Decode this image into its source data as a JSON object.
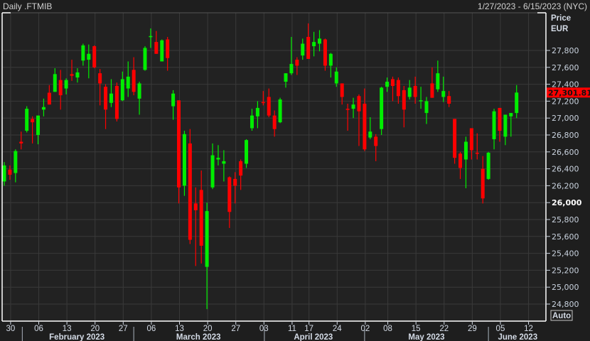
{
  "header": {
    "title": "Daily .FTMIB",
    "date_range": "1/27/2023 - 6/15/2023 (NYC)"
  },
  "axis": {
    "price_label": "Price",
    "currency_label": "EUR",
    "auto_button": "Auto",
    "last_price_label": "27,301.81"
  },
  "colors": {
    "up": "#00ee00",
    "down": "#ff0000",
    "background": "#1e1e1e",
    "plot": "#222222",
    "grid": "#3a3a3a"
  },
  "chart_data": {
    "type": "candlestick",
    "title": "Daily .FTMIB",
    "ylabel": "Price EUR",
    "ylim": [
      24700,
      28150
    ],
    "y_ticks": [
      24800,
      25000,
      25200,
      25400,
      25600,
      25800,
      26000,
      26200,
      26400,
      26600,
      26800,
      27000,
      27200,
      27400,
      27600,
      27800
    ],
    "y_tick_labels": [
      "24,800",
      "25,000",
      "25,200",
      "25,400",
      "25,600",
      "25,800",
      "26,000",
      "26,200",
      "26,400",
      "26,600",
      "26,800",
      "27,000",
      "27,200",
      "27,400",
      "27,600",
      "27,800"
    ],
    "y_bold_tick": 26000,
    "last_price": 27301.81,
    "x_ticks": [
      {
        "label": "30",
        "index": 1
      },
      {
        "label": "06",
        "index": 6
      },
      {
        "label": "13",
        "index": 11
      },
      {
        "label": "20",
        "index": 16
      },
      {
        "label": "27",
        "index": 21
      },
      {
        "label": "06",
        "index": 26
      },
      {
        "label": "13",
        "index": 31
      },
      {
        "label": "20",
        "index": 36
      },
      {
        "label": "27",
        "index": 41
      },
      {
        "label": "03",
        "index": 46
      },
      {
        "label": "11",
        "index": 51
      },
      {
        "label": "17",
        "index": 54
      },
      {
        "label": "24",
        "index": 59
      },
      {
        "label": "02",
        "index": 64
      },
      {
        "label": "08",
        "index": 68
      },
      {
        "label": "15",
        "index": 73
      },
      {
        "label": "22",
        "index": 78
      },
      {
        "label": "29",
        "index": 83
      },
      {
        "label": "05",
        "index": 88
      },
      {
        "label": "12",
        "index": 93
      }
    ],
    "months": [
      {
        "label": "February 2023",
        "start": 3.2,
        "center": 12.9
      },
      {
        "label": "March 2023",
        "start": 23,
        "center": 34.5
      },
      {
        "label": "April 2023",
        "start": 46.2,
        "center": 54.9
      },
      {
        "label": "May 2023",
        "start": 64,
        "center": 75
      },
      {
        "label": "June 2023",
        "start": 86,
        "center": 91.2
      }
    ],
    "candles_ohlc": [
      [
        26250,
        26480,
        26200,
        26440
      ],
      [
        26390,
        26440,
        26270,
        26330
      ],
      [
        26350,
        26630,
        26240,
        26610
      ],
      [
        26720,
        26840,
        26630,
        26700
      ],
      [
        26850,
        27140,
        26830,
        27110
      ],
      [
        26990,
        27020,
        26700,
        26950
      ],
      [
        26800,
        27030,
        26690,
        27030
      ],
      [
        27100,
        27230,
        27020,
        27130
      ],
      [
        27300,
        27390,
        27160,
        27160
      ],
      [
        27310,
        27590,
        27310,
        27520
      ],
      [
        27450,
        27570,
        27100,
        27270
      ],
      [
        27350,
        27470,
        27280,
        27450
      ],
      [
        27520,
        27690,
        27440,
        27500
      ],
      [
        27480,
        27590,
        27420,
        27540
      ],
      [
        27680,
        27880,
        27620,
        27860
      ],
      [
        27690,
        27870,
        27470,
        27760
      ],
      [
        27850,
        27860,
        27590,
        27600
      ],
      [
        27530,
        27580,
        27150,
        27410
      ],
      [
        27370,
        27400,
        26870,
        27100
      ],
      [
        27180,
        27460,
        27130,
        27290
      ],
      [
        27380,
        27420,
        26960,
        26990
      ],
      [
        27210,
        27550,
        27200,
        27460
      ],
      [
        27350,
        27670,
        27250,
        27490
      ],
      [
        27570,
        27720,
        27270,
        27310
      ],
      [
        27230,
        27430,
        27040,
        27410
      ],
      [
        27570,
        27850,
        27560,
        27830
      ],
      [
        27960,
        28060,
        27830,
        27970
      ],
      [
        27900,
        28030,
        27760,
        27760
      ],
      [
        27670,
        27930,
        27670,
        27920
      ],
      [
        27930,
        27960,
        27560,
        27710
      ],
      [
        27140,
        27330,
        26980,
        27290
      ],
      [
        27210,
        27210,
        25990,
        26180
      ],
      [
        26200,
        26850,
        26080,
        26810
      ],
      [
        26700,
        26870,
        25510,
        25560
      ],
      [
        25990,
        26180,
        25250,
        25910
      ],
      [
        26150,
        26380,
        25280,
        25490
      ],
      [
        25240,
        26000,
        24740,
        25900
      ],
      [
        26180,
        26700,
        26160,
        26560
      ],
      [
        26510,
        26680,
        26440,
        26530
      ],
      [
        26460,
        26620,
        26250,
        26490
      ],
      [
        26300,
        26310,
        25700,
        25890
      ],
      [
        26280,
        26360,
        25990,
        26200
      ],
      [
        26490,
        26510,
        26150,
        26320
      ],
      [
        26460,
        26750,
        26410,
        26740
      ],
      [
        26880,
        27110,
        26850,
        27030
      ],
      [
        27020,
        27200,
        26880,
        27120
      ],
      [
        27190,
        27320,
        27150,
        27180
      ],
      [
        27250,
        27350,
        27010,
        27030
      ],
      [
        27030,
        27090,
        26780,
        26870
      ],
      [
        26950,
        27240,
        26940,
        27220
      ],
      [
        27430,
        27530,
        27360,
        27530
      ],
      [
        27530,
        27960,
        27510,
        27640
      ],
      [
        27690,
        27720,
        27510,
        27620
      ],
      [
        27740,
        27940,
        27690,
        27880
      ],
      [
        27960,
        28120,
        27700,
        27700
      ],
      [
        27850,
        28020,
        27730,
        27900
      ],
      [
        27880,
        28040,
        27790,
        27940
      ],
      [
        27930,
        27940,
        27560,
        27620
      ],
      [
        27620,
        27770,
        27480,
        27760
      ],
      [
        27410,
        27600,
        27370,
        27550
      ],
      [
        27410,
        27410,
        27160,
        27250
      ],
      [
        27110,
        27170,
        26850,
        27100
      ],
      [
        27110,
        27240,
        27000,
        27160
      ],
      [
        27260,
        27280,
        26670,
        27080
      ],
      [
        27170,
        27350,
        26610,
        26630
      ],
      [
        26770,
        27010,
        26750,
        26840
      ],
      [
        26780,
        26810,
        26490,
        26670
      ],
      [
        26870,
        27370,
        26800,
        27360
      ],
      [
        27370,
        27480,
        27310,
        27430
      ],
      [
        27460,
        27490,
        27200,
        27380
      ],
      [
        27450,
        27480,
        27170,
        27260
      ],
      [
        27330,
        27380,
        26890,
        27100
      ],
      [
        27250,
        27450,
        27220,
        27360
      ],
      [
        27380,
        27490,
        27170,
        27250
      ],
      [
        27200,
        27370,
        27110,
        27210
      ],
      [
        27060,
        27250,
        26930,
        27200
      ],
      [
        27410,
        27600,
        27240,
        27240
      ],
      [
        27340,
        27680,
        27310,
        27530
      ],
      [
        27250,
        27490,
        27190,
        27320
      ],
      [
        27260,
        27320,
        27130,
        27170
      ],
      [
        26990,
        26990,
        26460,
        26530
      ],
      [
        26580,
        26600,
        26280,
        26410
      ],
      [
        26510,
        26780,
        26170,
        26720
      ],
      [
        26880,
        26880,
        26510,
        26620
      ],
      [
        26590,
        26820,
        26510,
        26580
      ],
      [
        26400,
        26550,
        25990,
        26050
      ],
      [
        26280,
        26600,
        26270,
        26590
      ],
      [
        26750,
        27110,
        26630,
        27080
      ],
      [
        27120,
        27120,
        26720,
        26850
      ],
      [
        26780,
        27040,
        26680,
        27040
      ],
      [
        27020,
        27060,
        26780,
        27060
      ],
      [
        27060,
        27390,
        27000,
        27301.81
      ]
    ]
  }
}
